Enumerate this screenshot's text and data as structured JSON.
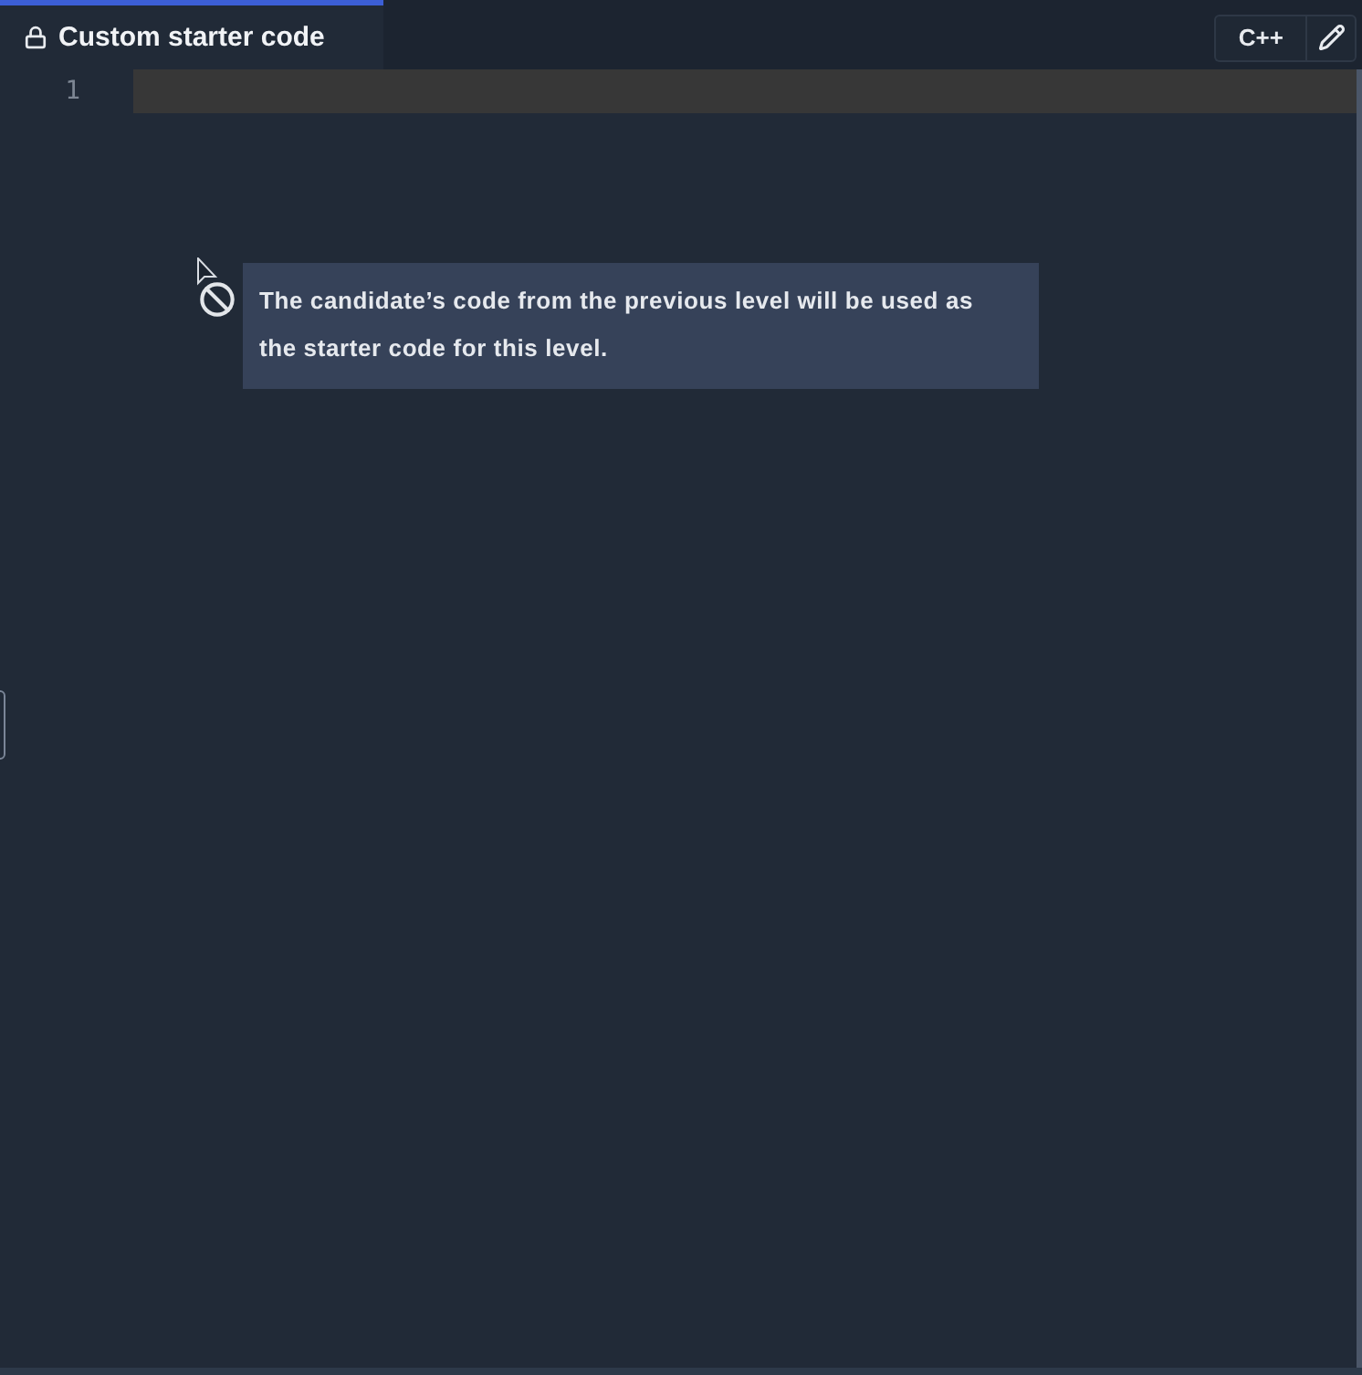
{
  "tab": {
    "label": "Custom starter code",
    "locked": true,
    "selected": true
  },
  "toolbar": {
    "language": "C++"
  },
  "editor": {
    "lines": [
      {
        "number": "1",
        "current": true
      }
    ]
  },
  "tooltip": {
    "text": "The candidate’s code from the previous level will be used as the starter code for this level."
  },
  "cursor": {
    "kind": "not-allowed"
  }
}
